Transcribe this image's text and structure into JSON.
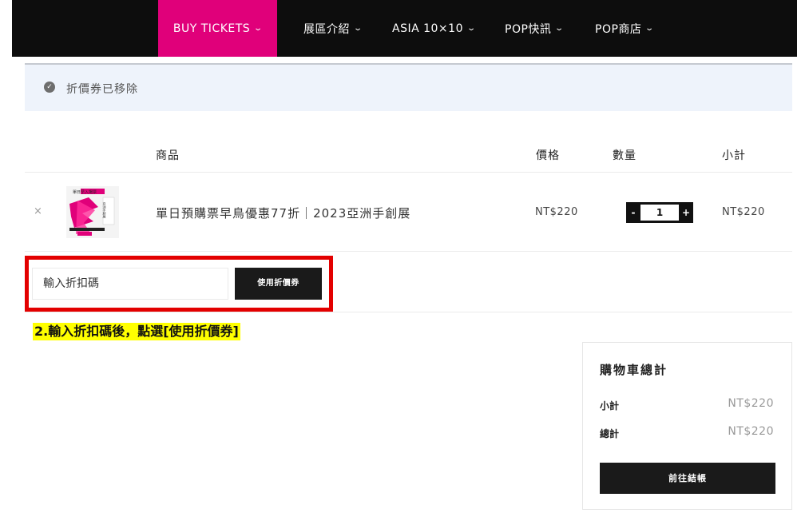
{
  "nav": {
    "items": [
      {
        "label": "BUY TICKETS"
      },
      {
        "label": "展區介紹"
      },
      {
        "label": "ASIA 10×10"
      },
      {
        "label": "POP快訊"
      },
      {
        "label": "POP商店"
      }
    ],
    "chevron": "⌄",
    "active_color": "#e0007a"
  },
  "notice": {
    "icon": "check-circle-icon",
    "text": "折價券已移除"
  },
  "table": {
    "headers": {
      "product": "商品",
      "price": "價格",
      "quantity": "數量",
      "subtotal": "小計"
    },
    "rows": [
      {
        "remove": "×",
        "name": "單日預購票早鳥優惠77折｜2023亞洲手創展",
        "price": "NT$220",
        "quantity": "1",
        "minus": "-",
        "plus": "+",
        "subtotal": "NT$220"
      }
    ]
  },
  "coupon": {
    "placeholder": "輸入折扣碼",
    "button": "使用折價券",
    "highlight_color": "#e30000"
  },
  "instruction": "2.輸入折扣碼後，點選[使用折價券]",
  "totals": {
    "title": "購物車總計",
    "subtotal_label": "小計",
    "subtotal_value": "NT$220",
    "total_label": "總計",
    "total_value": "NT$220",
    "checkout": "前往結帳"
  },
  "thumbnail_text": {
    "top": "單日早入場票",
    "side": "亞洲手創展"
  }
}
